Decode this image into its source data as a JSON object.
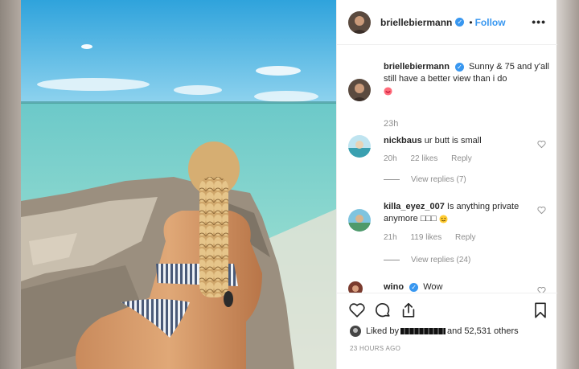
{
  "post": {
    "username": "brielleb iermann",
    "follow_label": "Follow",
    "more_label": "•••",
    "separator": "•"
  },
  "caption": {
    "username": "briellebiermann",
    "text": "Sunny & 75 and y'all still have a better view than i do",
    "time": "23h"
  },
  "comments": [
    {
      "username": "nickbaus",
      "text": "ur butt is small",
      "time": "20h",
      "likes": "22 likes",
      "reply": "Reply",
      "view_replies": "View replies (7)"
    },
    {
      "username": "killa_eyez_007",
      "text": "Is anything private anymore □□□",
      "time": "21h",
      "likes": "119 likes",
      "reply": "Reply",
      "view_replies": "View replies (24)"
    },
    {
      "username": "wino",
      "text": "Wow"
    }
  ],
  "footer": {
    "liked_by_prefix": "Liked by",
    "liked_by_suffix": "and 52,531 others",
    "timestamp": "23 HOURS AGO"
  },
  "colors": {
    "accent": "#3897f0",
    "text": "#262626",
    "muted": "#8e8e8e",
    "border": "#efefef"
  },
  "icons": [
    "verified-badge-icon",
    "more-options-icon",
    "heart-icon",
    "comment-icon",
    "share-icon",
    "bookmark-icon",
    "kiss-emoji-icon",
    "grin-emoji-icon"
  ]
}
